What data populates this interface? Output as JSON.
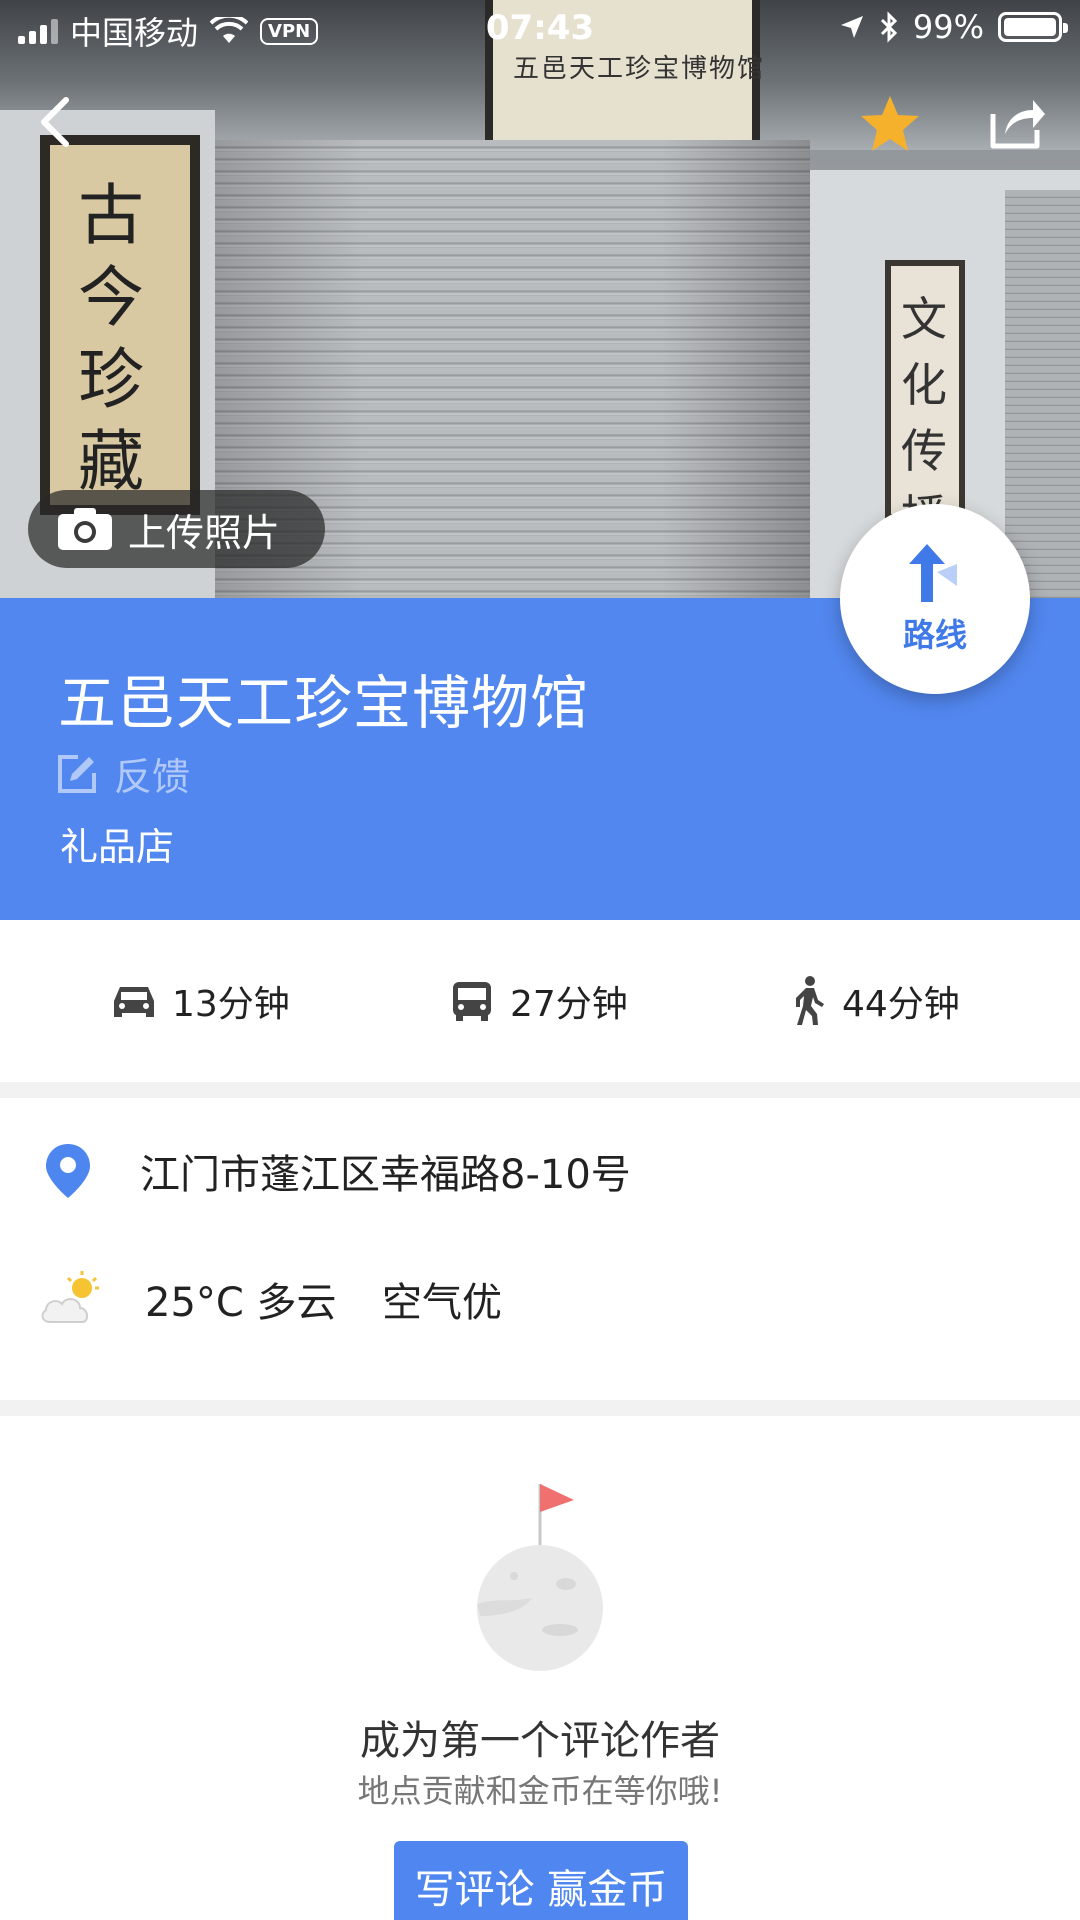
{
  "status_bar": {
    "carrier": "中国移动",
    "vpn": "VPN",
    "time": "07:43",
    "battery": "99%"
  },
  "hero": {
    "upload_label": "上传照片",
    "plaque_top": "五邑天工珍宝博物馆",
    "scroll_left": "古今珍藏",
    "scroll_right": "文化传播"
  },
  "poi": {
    "name": "五邑天工珍宝博物馆",
    "feedback_label": "反馈",
    "category": "礼品店",
    "route_label": "路线"
  },
  "travel": {
    "drive": "13分钟",
    "bus": "27分钟",
    "walk": "44分钟"
  },
  "info": {
    "address": "江门市蓬江区幸福路8-10号",
    "weather": "25°C 多云",
    "air": "空气优"
  },
  "review": {
    "title": "成为第一个评论作者",
    "subtitle": "地点贡献和金币在等你哦!",
    "button_label": "写评论 赢金币"
  },
  "colors": {
    "header_blue": "#5287ef",
    "accent_blue": "#3f7ae8",
    "star": "#f5b12c",
    "flag": "#f07070"
  }
}
